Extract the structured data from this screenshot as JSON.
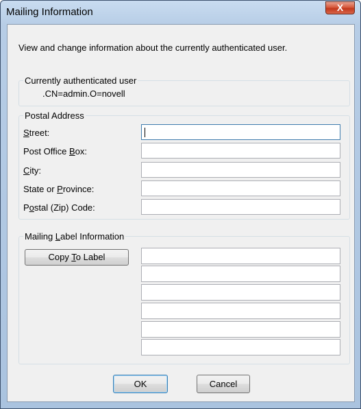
{
  "window": {
    "title": "Mailing Information",
    "close_glyph": "X"
  },
  "intro_text": "View and change information about the currently authenticated user.",
  "current_user": {
    "legend": "Currently authenticated user",
    "value": ".CN=admin.O=novell"
  },
  "postal": {
    "legend": "Postal Address",
    "fields": [
      {
        "pre": "",
        "mnemonic": "S",
        "post": "treet:",
        "value": ""
      },
      {
        "pre": "Post Office ",
        "mnemonic": "B",
        "post": "ox:",
        "value": ""
      },
      {
        "pre": "",
        "mnemonic": "C",
        "post": "ity:",
        "value": ""
      },
      {
        "pre": "State or ",
        "mnemonic": "P",
        "post": "rovince:",
        "value": ""
      },
      {
        "pre": "P",
        "mnemonic": "o",
        "post": "stal (Zip) Code:",
        "value": ""
      }
    ]
  },
  "mailing_label": {
    "legend_pre": "Mailing ",
    "legend_mnemonic": "L",
    "legend_post": "abel Information",
    "copy_button": {
      "pre": "Copy ",
      "mnemonic": "T",
      "post": "o Label"
    },
    "lines": [
      "",
      "",
      "",
      "",
      "",
      ""
    ]
  },
  "buttons": {
    "ok": "OK",
    "cancel": "Cancel"
  },
  "colors": {
    "title_gradient": "#b7cde6",
    "client_bg": "#f0f0f0",
    "close_red": "#c2381c"
  }
}
